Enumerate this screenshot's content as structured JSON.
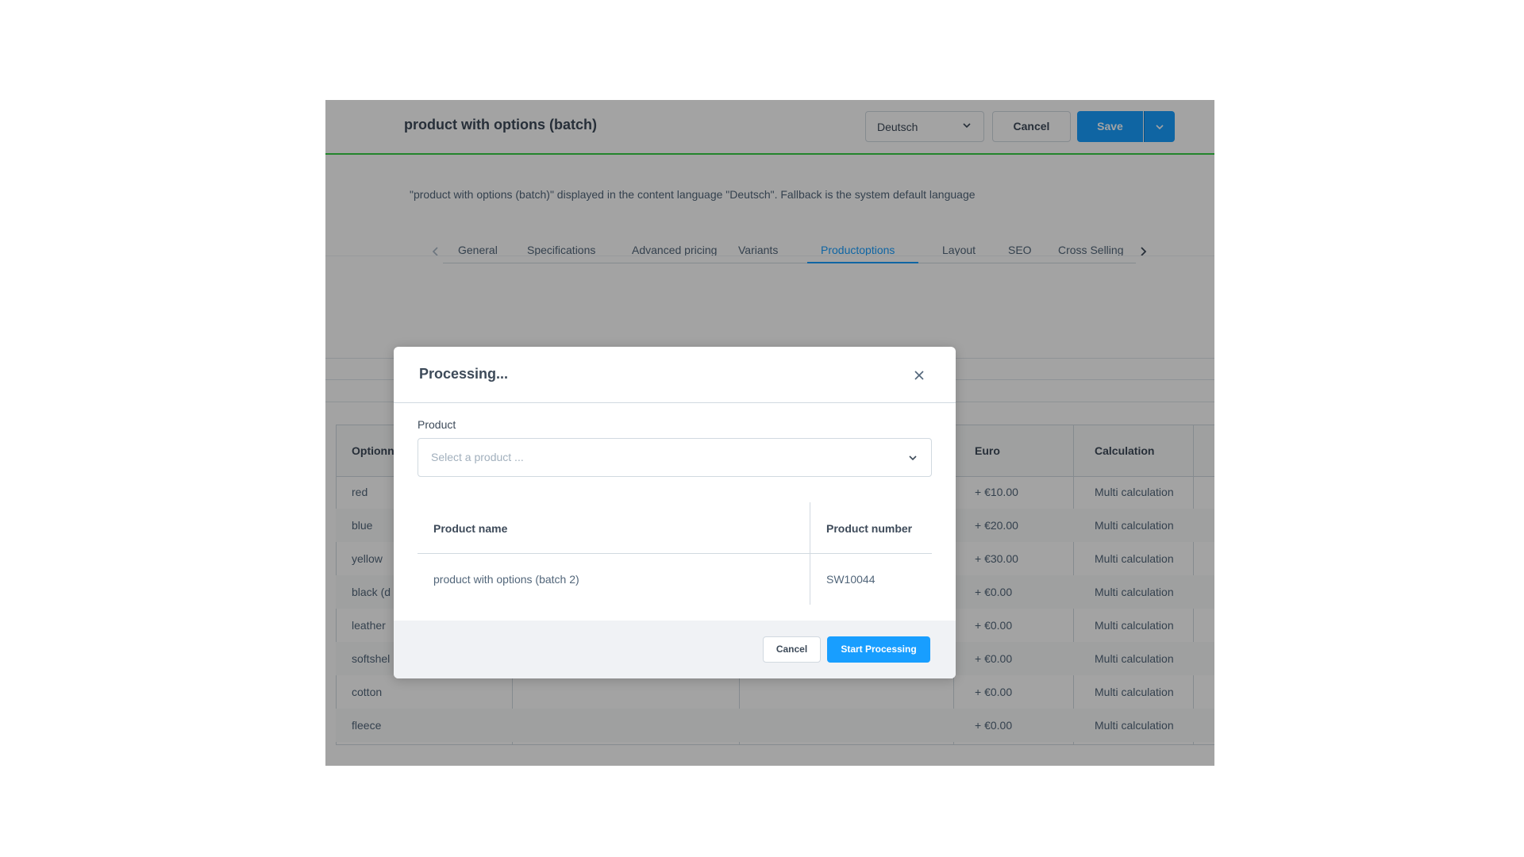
{
  "header": {
    "title": "product with options (batch)",
    "language": "Deutsch",
    "cancel_label": "Cancel",
    "save_label": "Save"
  },
  "language_info": "\"product with options (batch)\" displayed in the content language \"Deutsch\". Fallback is the system default language",
  "tabs": [
    {
      "label": "General"
    },
    {
      "label": "Specifications"
    },
    {
      "label": "Advanced pricing"
    },
    {
      "label": "Variants"
    },
    {
      "label": "Productoptions",
      "active": true
    },
    {
      "label": "Layout"
    },
    {
      "label": "SEO"
    },
    {
      "label": "Cross Selling"
    }
  ],
  "options_grid": {
    "columns": [
      "Optionn",
      "Euro",
      "Calculation"
    ],
    "rows": [
      {
        "name": "red",
        "euro": "+ €10.00",
        "calculation": "Multi calculation"
      },
      {
        "name": "blue",
        "euro": "+ €20.00",
        "calculation": "Multi calculation"
      },
      {
        "name": "yellow",
        "euro": "+ €30.00",
        "calculation": "Multi calculation"
      },
      {
        "name": "black (d",
        "euro": "+ €0.00",
        "calculation": "Multi calculation"
      },
      {
        "name": "leather",
        "euro": "+ €0.00",
        "calculation": "Multi calculation"
      },
      {
        "name": "softshel",
        "euro": "+ €0.00",
        "calculation": "Multi calculation"
      },
      {
        "name": "cotton",
        "euro": "+ €0.00",
        "calculation": "Multi calculation"
      },
      {
        "name": "fleece",
        "euro": "+ €0.00",
        "calculation": "Multi calculation"
      }
    ]
  },
  "modal": {
    "title": "Processing...",
    "product_label": "Product",
    "product_placeholder": "Select a product ...",
    "table": {
      "headers": [
        "Product name",
        "Product number"
      ],
      "rows": [
        {
          "name": "product with options (batch 2)",
          "number": "SW10044"
        }
      ]
    },
    "cancel_label": "Cancel",
    "start_label": "Start Processing"
  },
  "colors": {
    "accent": "#189eff",
    "header_border": "#37d046"
  }
}
